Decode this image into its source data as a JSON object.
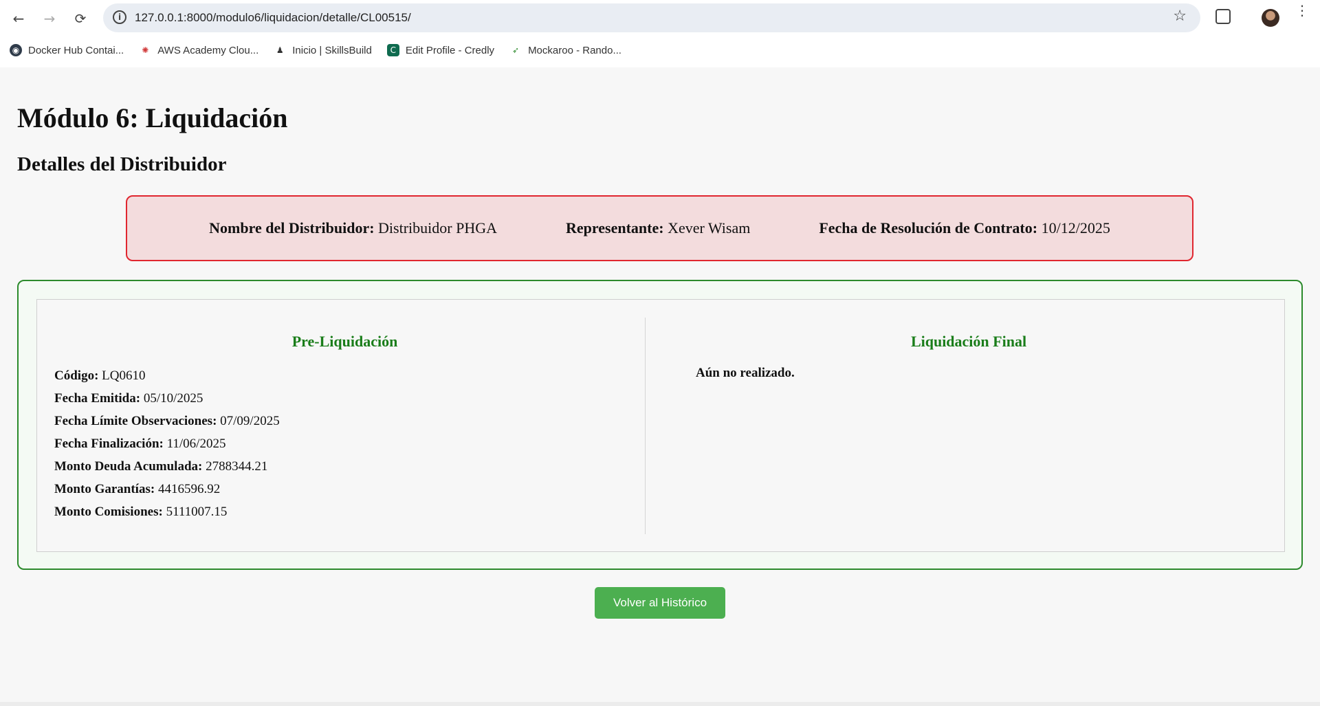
{
  "browser": {
    "url": "127.0.0.1:8000/modulo6/liquidacion/detalle/CL00515/",
    "nav": {
      "back": "←",
      "forward": "→",
      "reload": "⟳"
    },
    "info_icon": "i",
    "star_icon": "☆",
    "menu_icon": "⋮",
    "bookmarks": [
      {
        "label": "Docker Hub Contai...",
        "icon": "docker-icon",
        "glyph": "◉",
        "color": "#2f3b4a"
      },
      {
        "label": "AWS Academy Clou...",
        "icon": "aws-academy-icon",
        "glyph": "✺",
        "color": "#d13a3a"
      },
      {
        "label": "Inicio | SkillsBuild",
        "icon": "skillsbuild-icon",
        "glyph": "♟",
        "color": "#333333"
      },
      {
        "label": "Edit Profile - Credly",
        "icon": "credly-icon",
        "glyph": "C",
        "color": "#0f6b4f"
      },
      {
        "label": "Mockaroo - Rando...",
        "icon": "mockaroo-icon",
        "glyph": "➶",
        "color": "#2e8b2e"
      }
    ]
  },
  "page": {
    "title": "Módulo 6: Liquidación",
    "subtitle": "Detalles del Distribuidor"
  },
  "distributor": {
    "name_label": "Nombre del Distribuidor:",
    "name_value": "Distribuidor PHGA",
    "rep_label": "Representante:",
    "rep_value": "Xever Wisam",
    "date_label": "Fecha de Resolución de Contrato:",
    "date_value": "10/12/2025"
  },
  "pre_liquidacion": {
    "heading": "Pre-Liquidación",
    "fields": [
      {
        "label": "Código:",
        "value": "LQ0610"
      },
      {
        "label": "Fecha Emitida:",
        "value": "05/10/2025"
      },
      {
        "label": "Fecha Límite Observaciones:",
        "value": "07/09/2025"
      },
      {
        "label": "Fecha Finalización:",
        "value": "11/06/2025"
      },
      {
        "label": "Monto Deuda Acumulada:",
        "value": "2788344.21"
      },
      {
        "label": "Monto Garantías:",
        "value": "4416596.92"
      },
      {
        "label": "Monto Comisiones:",
        "value": "5111007.15"
      }
    ]
  },
  "liquidacion_final": {
    "heading": "Liquidación Final",
    "status": "Aún no realizado."
  },
  "actions": {
    "back_label": "Volver al Histórico"
  },
  "colors": {
    "accent_green": "#4caf50",
    "border_red": "#e0262f",
    "heading_green": "#1a7d1a"
  }
}
